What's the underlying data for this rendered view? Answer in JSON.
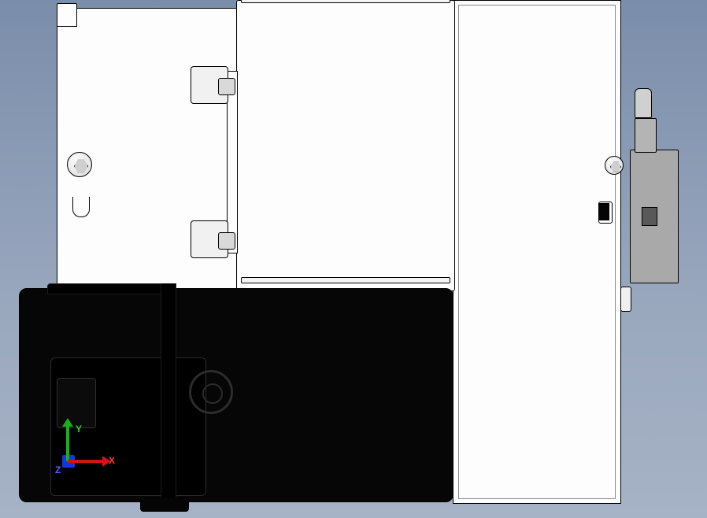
{
  "triad": {
    "x_label": "X",
    "y_label": "Y",
    "z_label": "Z",
    "x_color": "#d11515",
    "y_color": "#17b11a",
    "z_color": "#1436e0"
  }
}
